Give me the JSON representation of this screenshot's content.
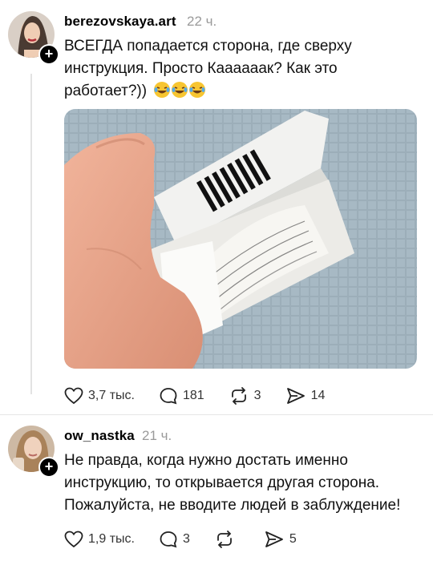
{
  "posts": [
    {
      "username": "berezovskaya.art",
      "time": "22 ч.",
      "text_lines": [
        "ВСЕГДА попадается сторона, где сверху",
        "инструкция. Просто Каааааак? Как это",
        "работает?))"
      ],
      "emoji": [
        "laughing-tears",
        "laughing-tears",
        "laughing-tears"
      ],
      "photo_barcode_digits": "",
      "stats": {
        "likes": "3,7 тыс.",
        "comments": "181",
        "reposts": "3",
        "shares": "14"
      }
    },
    {
      "username": "ow_nastka",
      "time": "21 ч.",
      "text_lines": [
        "Не правда, когда нужно достать именно",
        "инструкцию, то открывается другая сторона.",
        "Пожалуйста, не вводите людей в заблуждение!"
      ],
      "stats": {
        "likes": "1,9 тыс.",
        "comments": "3",
        "reposts": "",
        "shares": "5"
      }
    }
  ],
  "icons": {
    "like": "heart-icon",
    "comment": "comment-bubble-icon",
    "repost": "repost-icon",
    "share": "send-icon",
    "follow": "plus-icon"
  },
  "colors": {
    "time": "#9a9a9a",
    "divider": "#e6e6e6",
    "badge": "#000000"
  }
}
